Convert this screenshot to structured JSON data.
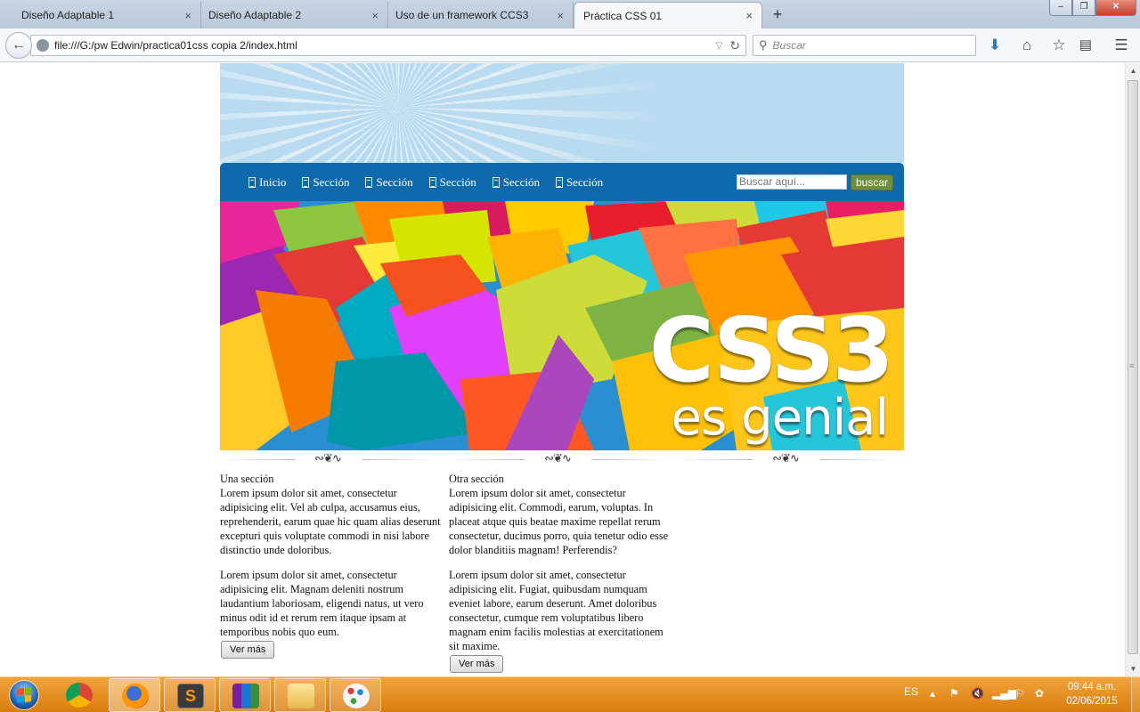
{
  "browser": {
    "tabs": [
      {
        "title": "Diseño Adaptable 1",
        "active": false
      },
      {
        "title": "Diseño Adaptable 2",
        "active": false
      },
      {
        "title": "Uso de un framework CCS3",
        "active": false
      },
      {
        "title": "Práctica CSS 01",
        "active": true
      }
    ],
    "close_glyph": "×",
    "new_tab_glyph": "+",
    "window_buttons": {
      "minimize": "–",
      "restore": "❐",
      "close": "✕"
    },
    "url": "file:///G:/pw Edwin/practica01css copia 2/index.html",
    "search_placeholder": "Buscar",
    "toolbar_icons": [
      "download-icon",
      "home-icon",
      "bookmark-star-icon",
      "reading-list-icon",
      "menu-icon"
    ]
  },
  "site": {
    "nav": {
      "items": [
        "Inicio",
        "Sección",
        "Sección",
        "Sección",
        "Sección",
        "Sección"
      ],
      "search_placeholder": "Buscar aquí...",
      "search_button": "buscar"
    },
    "hero": {
      "title": "CSS3",
      "subtitle": "es genial"
    },
    "divider_ornament": "∾❦∿",
    "sections": [
      {
        "heading": "Una sección",
        "paragraphs": [
          "Lorem ipsum dolor sit amet, consectetur adipisicing elit. Vel ab culpa, accusamus eius, reprehenderit, earum quae hic quam alias deserunt excepturi quis voluptate commodi in nisi labore distinctio unde doloribus.",
          "Lorem ipsum dolor sit amet, consectetur adipisicing elit. Magnam deleniti nostrum laudantium laboriosam, eligendi natus, ut vero minus odit id et rerum rem itaque ipsam at temporibus nobis quo eum."
        ],
        "button": "Ver más"
      },
      {
        "heading": "Otra sección",
        "paragraphs": [
          "Lorem ipsum dolor sit amet, consectetur adipisicing elit. Commodi, earum, voluptas. In placeat atque quis beatae maxime repellat rerum consectetur, ducimus porro, quia tenetur odio esse dolor blanditiis magnam! Perferendis?",
          "Lorem ipsum dolor sit amet, consectetur adipisicing elit. Fugiat, quibusdam numquam eveniet labore, earum deserunt. Amet doloribus consectetur, cumque rem voluptatibus libero magnam enim facilis molestias at exercitationem sit maxime."
        ],
        "button": "Ver más"
      }
    ]
  },
  "taskbar": {
    "apps": [
      "chrome-icon",
      "firefox-icon",
      "sublime-text-icon",
      "winrar-icon",
      "file-explorer-icon",
      "paint-icon"
    ],
    "language": "ES",
    "time": "09:44 a.m.",
    "date": "02/06/2015"
  },
  "colors": {
    "nav_blue": "#0f6aad",
    "header_sky": "#b9dbef",
    "search_button_green": "#6e8e3c",
    "taskbar_orange": "#e8901f"
  }
}
